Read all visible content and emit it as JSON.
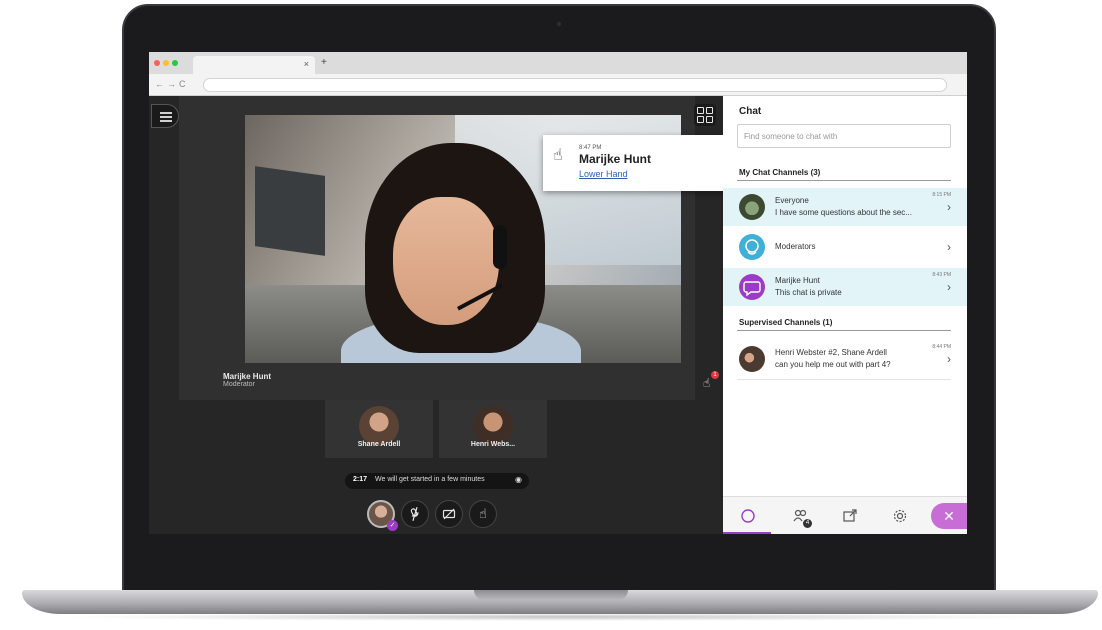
{
  "browser": {
    "tab_close": "×",
    "new_tab": "+",
    "nav_back": "←",
    "nav_forward": "→",
    "nav_reload": "C"
  },
  "video": {
    "presenter_name": "Marijke Hunt",
    "presenter_role": "Moderator",
    "raised_hands_count": "1"
  },
  "notification": {
    "time": "8:47 PM",
    "name": "Marijke Hunt",
    "action": "Lower Hand",
    "close": "×"
  },
  "participants": [
    {
      "name": "Shane Ardell"
    },
    {
      "name": "Henri Webs..."
    }
  ],
  "status": {
    "time": "2:17",
    "message": "We will get started in a few minutes",
    "eye_icon": "eye-icon"
  },
  "chat": {
    "title": "Chat",
    "search_placeholder": "Find someone to chat with",
    "my_channels_title": "My Chat Channels (3)",
    "supervised_title": "Supervised Channels (1)",
    "channels": [
      {
        "name": "Everyone",
        "preview": "I have some questions about the sec...",
        "time": "8:15 PM",
        "icon": "group-photo-icon",
        "highlighted": true
      },
      {
        "name": "Moderators",
        "preview": "",
        "time": "",
        "icon": "moderators-icon",
        "highlighted": false
      },
      {
        "name": "Marijke Hunt",
        "preview": "This chat is private",
        "time": "8:43 PM",
        "icon": "private-chat-icon",
        "highlighted": true
      }
    ],
    "supervised": [
      {
        "name": "Henri Webster #2, Shane Ardell",
        "preview": "can you help me out with part 4?",
        "time": "8:44 PM",
        "icon": "participants-photo-icon"
      }
    ],
    "people_count": "4",
    "accent": "#9b3cc6"
  }
}
